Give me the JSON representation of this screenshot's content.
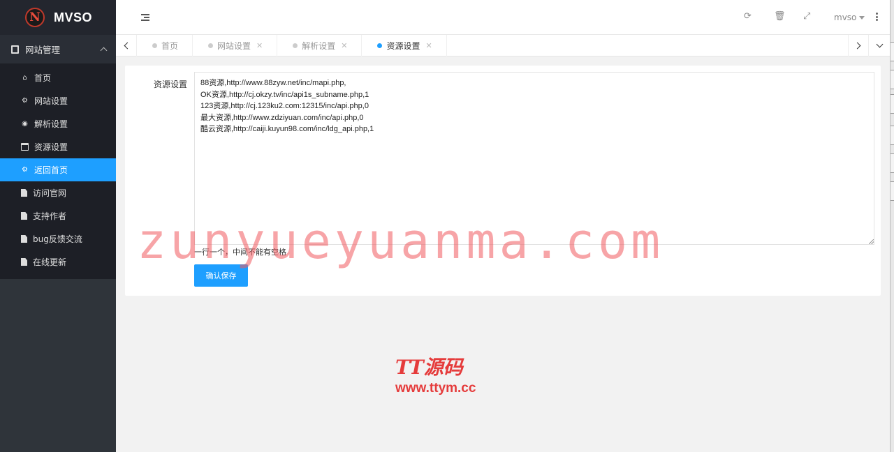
{
  "app": {
    "logo_letter": "N",
    "name": "MVSO"
  },
  "sidebar": {
    "group_label": "网站管理",
    "items": [
      {
        "label": "首页",
        "icon": "home-icon"
      },
      {
        "label": "网站设置",
        "icon": "gear-icon"
      },
      {
        "label": "解析设置",
        "icon": "dashboard-icon"
      },
      {
        "label": "资源设置",
        "icon": "window-icon"
      },
      {
        "label": "返回首页",
        "icon": "cogs-icon"
      },
      {
        "label": "访问官网",
        "icon": "file-icon"
      },
      {
        "label": "支持作者",
        "icon": "file-icon"
      },
      {
        "label": "bug反馈交流",
        "icon": "file-icon"
      },
      {
        "label": "在线更新",
        "icon": "file-icon"
      }
    ]
  },
  "header": {
    "user": "mvso"
  },
  "tabs": [
    {
      "label": "首页",
      "closable": false
    },
    {
      "label": "网站设置",
      "closable": true
    },
    {
      "label": "解析设置",
      "closable": true
    },
    {
      "label": "资源设置",
      "closable": true,
      "active": true
    }
  ],
  "form": {
    "label": "资源设置",
    "value": "88资源,http://www.88zyw.net/inc/mapi.php,\nOK资源,http://cj.okzy.tv/inc/api1s_subname.php,1\n123资源,http://cj.123ku2.com:12315/inc/api.php,0\n最大资源,http://www.zdziyuan.com/inc/api.php,0\n酷云资源,http://caiji.kuyun98.com/inc/ldg_api.php,1",
    "hint": "一行一个，中间不能有空格",
    "submit": "确认保存"
  },
  "watermarks": {
    "main": "zunyueyuanma.com",
    "logo_title": "TT源码",
    "logo_url": "www.ttym.cc"
  },
  "colors": {
    "accent": "#1e9fff",
    "sidebar": "#2f343a",
    "watermark": "#e53b3b"
  }
}
